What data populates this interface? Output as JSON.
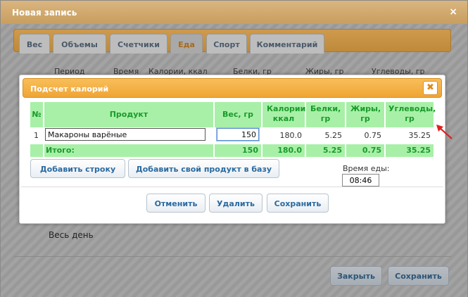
{
  "outer": {
    "title": "Новая запись",
    "close_glyph": "×",
    "tabs": [
      {
        "label": "Вес"
      },
      {
        "label": "Объемы"
      },
      {
        "label": "Счетчики"
      },
      {
        "label": "Еда"
      },
      {
        "label": "Спорт"
      },
      {
        "label": "Комментарий"
      }
    ],
    "column_headers": [
      "Период",
      "Время",
      "Калории, ккал",
      "Белки, гр",
      "Жиры, гр",
      "Углеводы, гр"
    ],
    "allday_label": "Весь день",
    "close_button": "Закрыть",
    "save_button": "Сохранить"
  },
  "modal": {
    "title": "Подсчет калорий",
    "close_glyph": "✖",
    "table": {
      "headers": {
        "num": "№",
        "product": "Продукт",
        "weight": "Вес, гр",
        "calories": "Калории, ккал",
        "protein": "Белки, гр",
        "fat": "Жиры, гр",
        "carbs": "Углеводы, гр"
      },
      "rows": [
        {
          "num": "1",
          "product": "Макароны варёные",
          "weight": "150",
          "calories": "180.0",
          "protein": "5.25",
          "fat": "0.75",
          "carbs": "35.25"
        }
      ],
      "total": {
        "label": "Итого:",
        "weight": "150",
        "calories": "180.0",
        "protein": "5.25",
        "fat": "0.75",
        "carbs": "35.25"
      }
    },
    "add_row_button": "Добавить строку",
    "add_product_button": "Добавить свой продукт в базу",
    "meal_time_label": "Время еды:",
    "meal_time_value": "08:46",
    "cancel_button": "Отменить",
    "delete_button": "Удалить",
    "save_button": "Сохранить"
  },
  "colors": {
    "accent_orange": "#f0a535",
    "header_green": "#a8f0a8",
    "header_text_green": "#1a9a2a",
    "button_text_blue": "#2a6aa0",
    "arrow_red": "#e02020"
  }
}
